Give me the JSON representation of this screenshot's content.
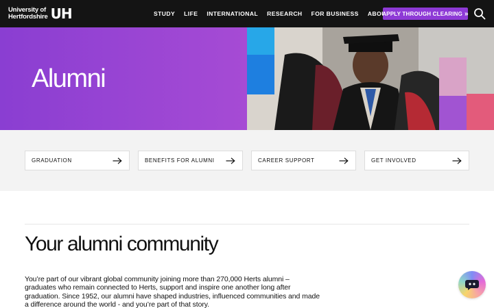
{
  "header": {
    "logo": {
      "line1": "University of",
      "line2": "Hertfordshire",
      "mark": "UH"
    },
    "nav": [
      "STUDY",
      "LIFE",
      "INTERNATIONAL",
      "RESEARCH",
      "FOR BUSINESS",
      "ABOUT US"
    ],
    "cta_label": "APPLY THROUGH CLEARING",
    "search_icon": "search-icon"
  },
  "hero": {
    "title": "Alumni",
    "image": "graduate-ceremony-photo"
  },
  "quick_links": [
    {
      "label": "GRADUATION"
    },
    {
      "label": "BENEFITS FOR ALUMNI"
    },
    {
      "label": "CAREER SUPPORT"
    },
    {
      "label": "GET INVOLVED"
    }
  ],
  "content": {
    "title": "Your alumni community",
    "intro": "You’re part of our vibrant global community joining more than 270,000 Herts alumni – graduates who remain connected to Herts, support and inspire one another long after graduation. Since 1952, our alumni have shaped industries, influenced communities and made a difference around the world - and you’re part of that story."
  },
  "colors": {
    "header_bg": "#141414",
    "accent_purple": "#8e3ad6",
    "band_bg": "#f3f3f3"
  },
  "chat_icon": "chatbot-icon"
}
